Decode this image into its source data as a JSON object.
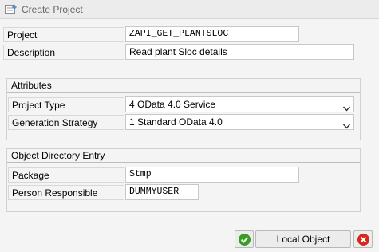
{
  "window": {
    "title": "Create Project",
    "icon": "create-document-icon"
  },
  "form": {
    "project_label": "Project",
    "project_value": "ZAPI_GET_PLANTSLOC",
    "description_label": "Description",
    "description_value": "Read plant Sloc details"
  },
  "attributes": {
    "title": "Attributes",
    "project_type_label": "Project Type",
    "project_type_value": "4 OData 4.0 Service",
    "generation_strategy_label": "Generation Strategy",
    "generation_strategy_value": "1 Standard OData 4.0"
  },
  "object_directory": {
    "title": "Object Directory Entry",
    "package_label": "Package",
    "package_value": "$tmp",
    "person_label": "Person Responsible",
    "person_value": "DUMMYUSER"
  },
  "footer": {
    "confirm_icon": "check-icon",
    "local_object_label": "Local Object",
    "cancel_icon": "close-icon"
  },
  "colors": {
    "confirm_green": "#3a9d23",
    "cancel_red": "#d9261c"
  }
}
